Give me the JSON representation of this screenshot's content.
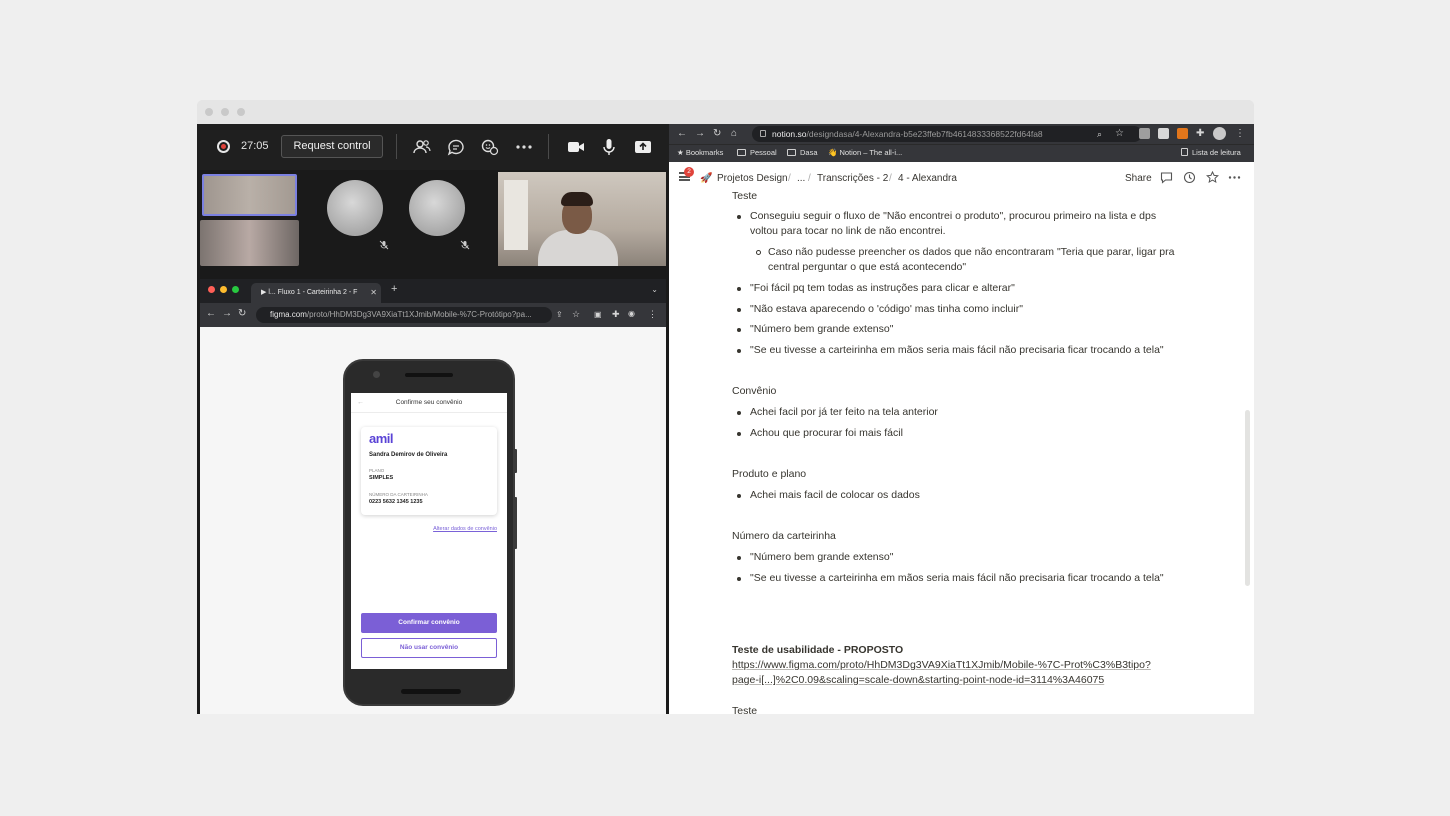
{
  "call": {
    "timer": "27:05",
    "request_control_label": "Request control"
  },
  "figma_browser": {
    "tab_title": "▶ l... Fluxo 1 - Carteirinha 2 - F",
    "url_domain": "figma.com",
    "url_path": "/proto/HhDM3Dg3VA9XiaTt1XJmib/Mobile-%7C-Protótipo?pa..."
  },
  "prototype": {
    "header": "Confirme seu convênio",
    "brand": "amil",
    "member_name": "Sandra Demirov de Oliveira",
    "plan_label": "PLANO",
    "plan_value": "SIMPLES",
    "card_number_label": "NÚMERO DA CARTEIRINHA",
    "card_number_value": "0223 5632 1345 1235",
    "alter_link": "Alterar dados de convênio",
    "confirm_button": "Confirmar convênio",
    "skip_button": "Não usar convênio"
  },
  "browser": {
    "url_domain": "notion.so",
    "url_path": "/designdasa/4-Alexandra-b5e23ffeb7fb4614833368522fd64fa8",
    "bookmarks": [
      "Bookmarks",
      "Pessoal",
      "Dasa",
      "Notion – The all-i..."
    ],
    "reading_list": "Lista de leitura"
  },
  "notion": {
    "badge": "2",
    "breadcrumb": [
      "Projetos Design",
      "...",
      "Transcrições - 2",
      "4 - Alexandra"
    ],
    "share": "Share",
    "content": {
      "heading_teste_1": "Teste",
      "b1_l1": "Conseguiu seguir o fluxo de \"Não encontrei o produto\", procurou primeiro na lista e dps",
      "b1_l2": "voltou para tocar no link de não encontrei.",
      "sub1_l1": "Caso não pudesse preencher os dados que não encontraram \"Teria que parar, ligar pra",
      "sub1_l2": "central perguntar o que está acontecendo\"",
      "b2": "\"Foi fácil pq tem todas as instruções para clicar e alterar\"",
      "b3": "\"Não estava aparecendo o 'código' mas tinha como incluir\"",
      "b4": "\"Número bem grande extenso\"",
      "b5": "\"Se eu tivesse a carteirinha em mãos seria mais fácil não precisaria ficar trocando a tela\"",
      "heading_convenio": "Convênio",
      "c1": "Achei facil por já ter feito na tela anterior",
      "c2": "Achou que procurar foi mais fácil",
      "heading_produto": "Produto e plano",
      "p1": "Achei mais facil de colocar os dados",
      "heading_numero": "Número da carteirinha",
      "n1": "\"Número bem grande extenso\"",
      "n2": "\"Se eu tivesse a carteirinha em mãos seria mais fácil não precisaria ficar trocando a tela\"",
      "usability_title": "Teste de usabilidade - PROPOSTO",
      "usability_link_l1": "https://www.figma.com/proto/HhDM3Dg3VA9XiaTt1XJmib/Mobile-%7C-Prot%C3%B3tipo?",
      "usability_link_l2": "page-i[...]%2C0.09&scaling=scale-down&starting-point-node-id=3114%3A46075",
      "heading_teste_2": "Teste"
    },
    "help": "?"
  },
  "colors": {
    "notion_text": "#37352f",
    "amil_brand": "#5a43d6",
    "primary_button": "#7b5fd6",
    "recording_red": "#e0433b",
    "selected_tile_border": "#7b80e0"
  },
  "icons": [
    "record-icon",
    "participants-icon",
    "chat-icon",
    "reactions-icon",
    "more-icon",
    "camera-icon",
    "microphone-icon",
    "share-screen-icon",
    "mic-muted-icon",
    "bookmark-star-icon",
    "folder-icon",
    "menu-icon",
    "comment-icon",
    "history-icon",
    "favorite-star-icon",
    "more-horizontal-icon",
    "help-icon"
  ]
}
